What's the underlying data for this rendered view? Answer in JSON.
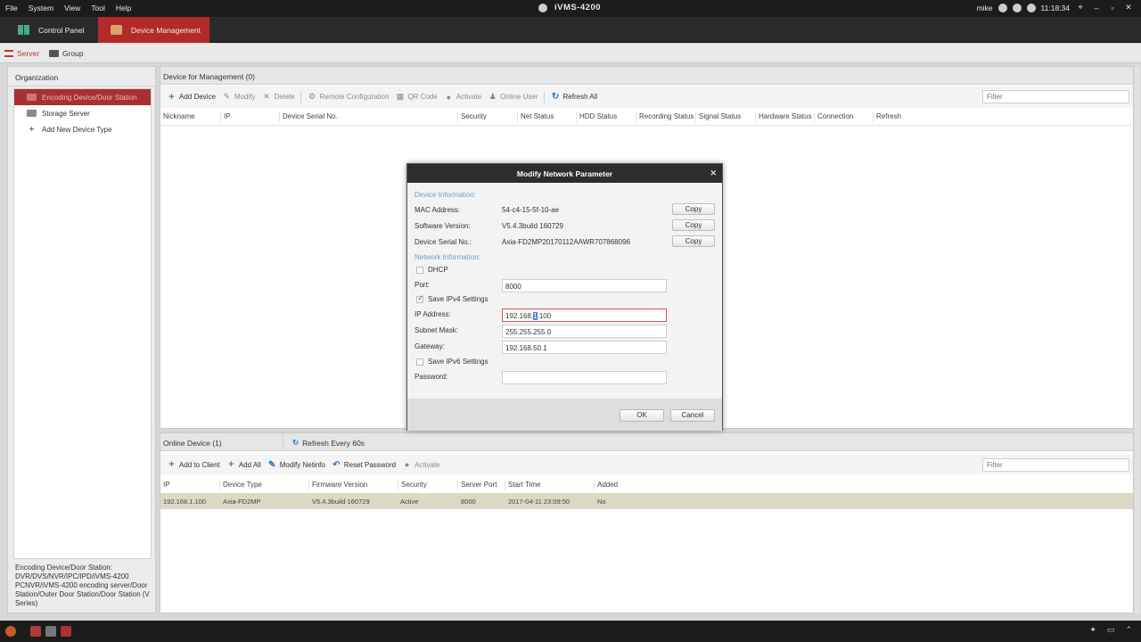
{
  "titlebar": {
    "menus": [
      "File",
      "System",
      "View",
      "Tool",
      "Help"
    ],
    "title": "iVMS-4200",
    "user": "mike",
    "time": "11:18:34",
    "window_controls": [
      "pin-icon",
      "minimize-icon",
      "maximize-icon",
      "close-icon"
    ]
  },
  "modules": {
    "control_panel": "Control Panel",
    "device_management": "Device Management"
  },
  "subtabs": {
    "server": "Server",
    "group": "Group"
  },
  "left": {
    "header": "Organization",
    "items": [
      "Encoding Device/Door Station",
      "Storage Server",
      "Add New Device Type"
    ],
    "description": "Encoding Device/Door Station: DVR/DVS/NVR/IPC/IPD/iVMS-4200 PCNVR/iVMS-4200 encoding server/Door Station/Outer Door Station/Door Station (V Series)"
  },
  "main": {
    "header": "Device for Management (0)",
    "toolbar": [
      "Add Device",
      "Modify",
      "Delete",
      "Remote Configuration",
      "QR Code",
      "Activate",
      "Online User",
      "Refresh All"
    ],
    "filter_placeholder": "Filter",
    "columns": [
      "Nickname",
      "IP",
      "Device Serial No.",
      "Security",
      "Net Status",
      "HDD Status",
      "Recording Status",
      "Signal Status",
      "Hardware Status",
      "Connection",
      "Refresh"
    ]
  },
  "online": {
    "header": "Online Device (1)",
    "refresh": "Refresh Every 60s",
    "toolbar": [
      "Add to Client",
      "Add All",
      "Modify Netinfo",
      "Reset Password",
      "Activate"
    ],
    "filter_placeholder": "Filter",
    "columns": [
      "IP",
      "Device Type",
      "Firmware Version",
      "Security",
      "Server Port",
      "Start Time",
      "Added"
    ],
    "rows": [
      [
        "192.168.1.100",
        "Axia-FD2MP",
        "V5.4.3build 160729",
        "Active",
        "8000",
        "2017-04-11 23:09:50",
        "No"
      ]
    ]
  },
  "dialog": {
    "title": "Modify Network Parameter",
    "device_info": "Device Information:",
    "mac_label": "MAC Address:",
    "mac_value": "54-c4-15-5f-10-ae",
    "sw_label": "Software Version:",
    "sw_value": "V5.4.3build 160729",
    "serial_label": "Device Serial No.:",
    "serial_value": "Axia-FD2MP20170112AAWR707868096",
    "copy": "Copy",
    "network_info": "Network Information:",
    "dhcp": "DHCP",
    "port_label": "Port:",
    "port_value": "8000",
    "save_ipv4": "Save IPv4 Settings",
    "ip_label": "IP Address:",
    "ip_value_pre": "192.168.",
    "ip_value_sel": "1",
    "ip_value_post": ".100",
    "mask_label": "Subnet Mask:",
    "mask_value": "255.255.255.0",
    "gw_label": "Gateway:",
    "gw_value": "192.168.50.1",
    "save_ipv6": "Save IPv6 Settings",
    "pw_label": "Password:",
    "ok": "OK",
    "cancel": "Cancel"
  },
  "colors": {
    "accent": "#b22a2a",
    "link": "#6b9bc9",
    "row_highlight": "#ddd7c6"
  }
}
